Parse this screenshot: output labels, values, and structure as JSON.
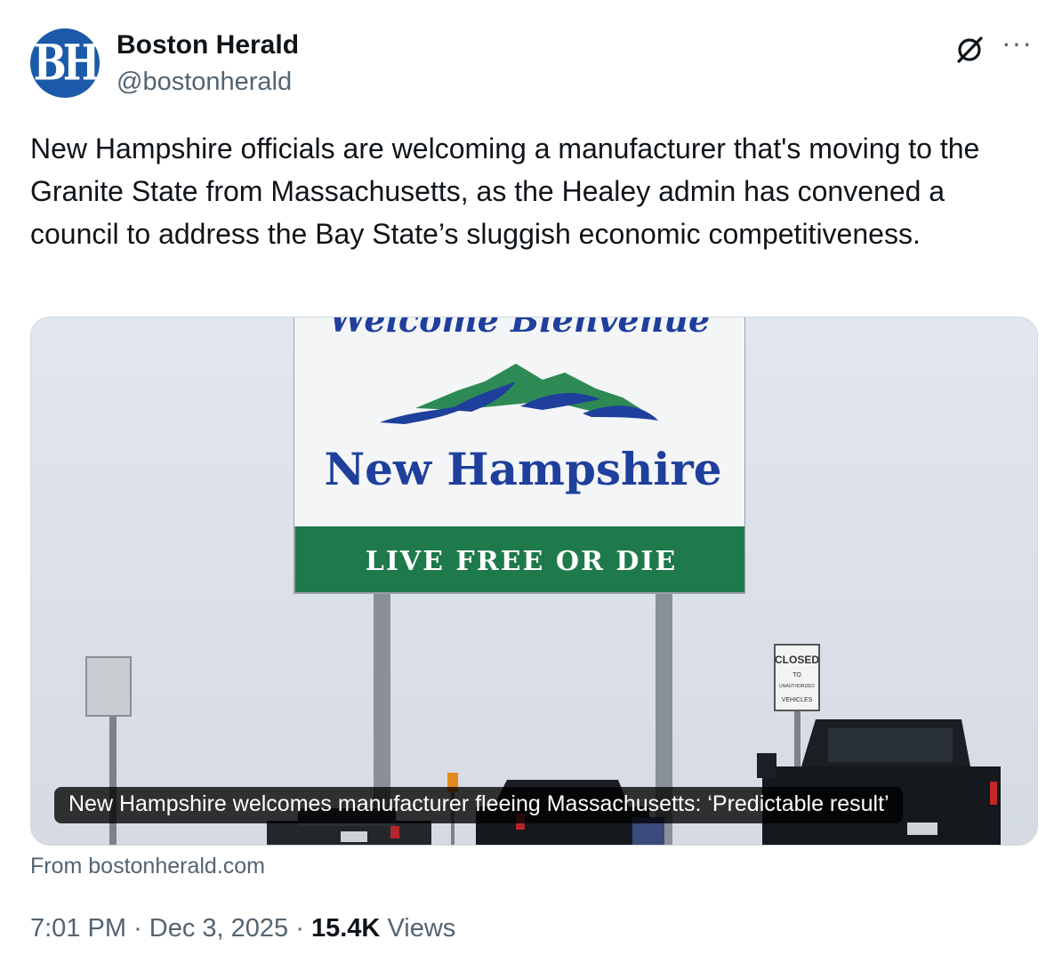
{
  "tweet": {
    "author": {
      "avatar_text": "BH",
      "display_name": "Boston Herald",
      "handle": "@bostonherald"
    },
    "header_icons": [
      "grok-icon",
      "more-options-icon"
    ],
    "more_label": "···",
    "text": "New Hampshire officials are welcoming a manufacturer that's moving to the Granite State from Massachusetts, as the Healey admin has convened a council to address the Bay State’s sluggish economic competitiveness.",
    "link_card": {
      "image_sign": {
        "welcome_text": "Welcome Bienvenue",
        "state_name": "New Hampshire",
        "motto": "LIVE FREE OR DIE",
        "closed_sign": [
          "CLOSED",
          "TO",
          "UNAUTHORIZED",
          "VEHICLES"
        ]
      },
      "caption": "New Hampshire welcomes manufacturer fleeing Massachusetts: ‘Predictable result’",
      "source": "From bostonherald.com"
    },
    "meta": {
      "time": "7:01 PM",
      "separator": "·",
      "date": "Dec 3, 2025",
      "views_count": "15.4K",
      "views_label": "Views"
    }
  },
  "colors": {
    "sign_green": "#1e7a4a",
    "sign_blue": "#1f3f9c",
    "avatar_blue": "#1a5aa8",
    "secondary_text": "#536471"
  }
}
